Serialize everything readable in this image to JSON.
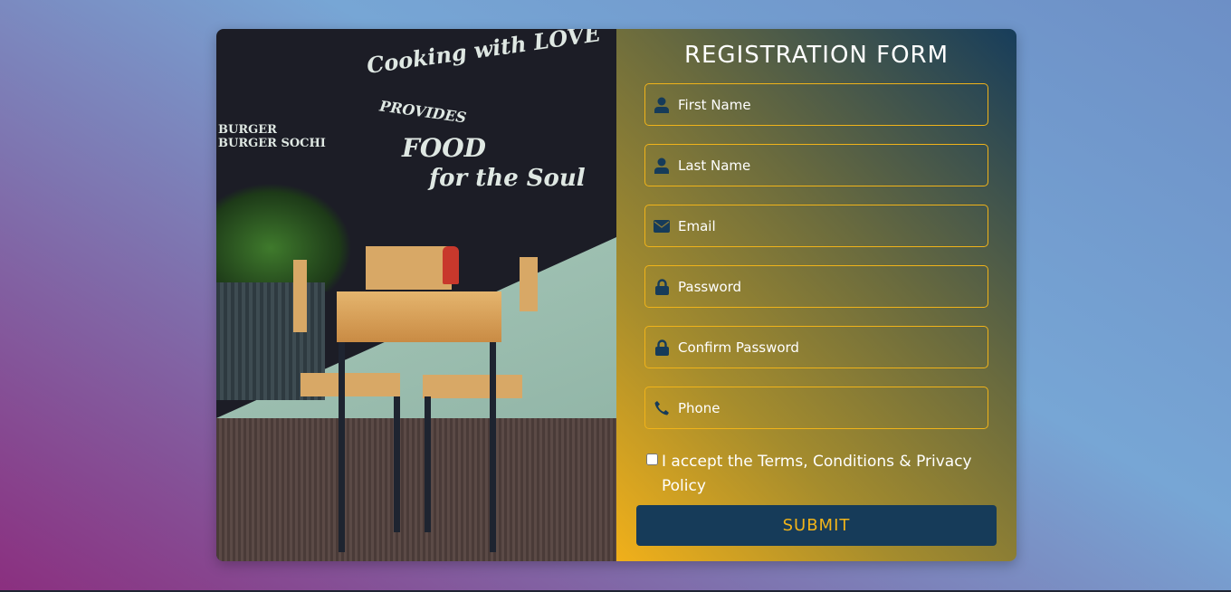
{
  "form": {
    "title": "REGISTRATION FORM",
    "fields": [
      {
        "placeholder": "First Name",
        "icon": "user-icon"
      },
      {
        "placeholder": "Last Name",
        "icon": "user-icon"
      },
      {
        "placeholder": "Email",
        "icon": "envelope-icon"
      },
      {
        "placeholder": "Password",
        "icon": "lock-icon"
      },
      {
        "placeholder": "Confirm Password",
        "icon": "lock-icon"
      },
      {
        "placeholder": "Phone",
        "icon": "phone-icon"
      }
    ],
    "terms_label": "I accept the Terms, Conditions & Privacy Policy",
    "terms_checked": false,
    "submit_label": "SUBMIT"
  },
  "photo": {
    "chalk_text": [
      "Cooking with LOVE provides FOOD for the Soul",
      "Burger",
      "Burger Sochi"
    ]
  },
  "colors": {
    "accent": "#f0b31a",
    "button": "#163b59",
    "icon": "#163b59"
  }
}
